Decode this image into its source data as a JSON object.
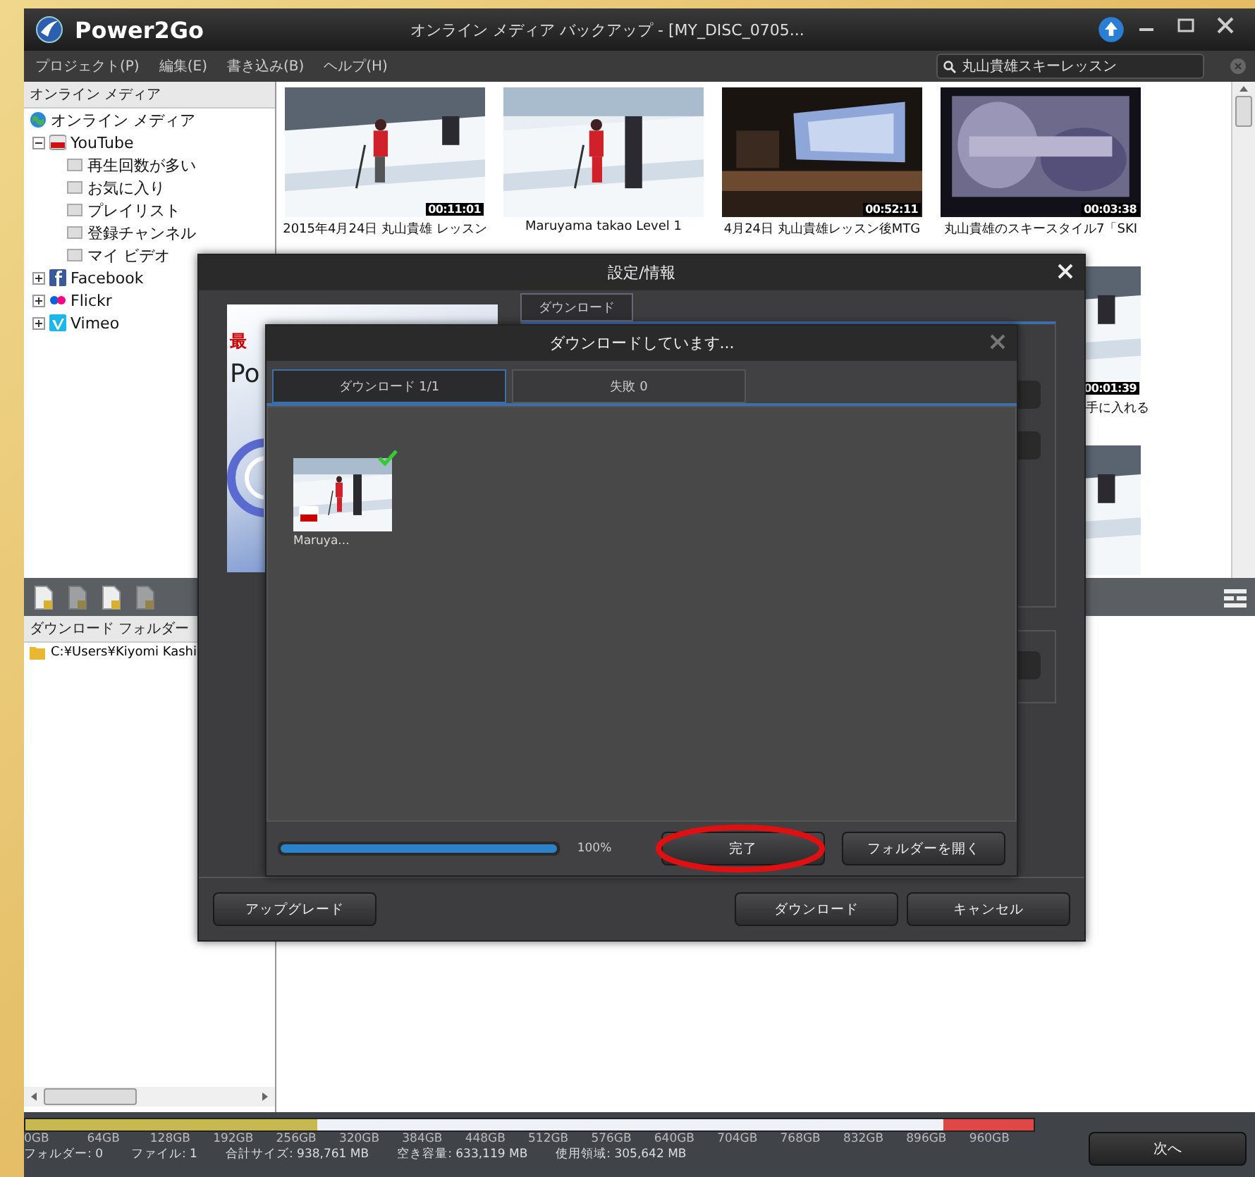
{
  "window": {
    "app_name": "Power2Go",
    "title": "オンライン メディア バックアップ - [MY_DISC_0705..."
  },
  "menu": [
    "プロジェクト(P)",
    "編集(E)",
    "書き込み(B)",
    "ヘルプ(H)"
  ],
  "search": {
    "value": "丸山貴雄スキーレッスン"
  },
  "sidebar": {
    "header": "オンライン メディア",
    "root": {
      "label": "オンライン メディア",
      "children": [
        {
          "label": "YouTube",
          "kind": "youtube",
          "expanded": true,
          "children": [
            {
              "label": "再生回数が多い"
            },
            {
              "label": "お気に入り"
            },
            {
              "label": "プレイリスト"
            },
            {
              "label": "登録チャンネル"
            },
            {
              "label": "マイ ビデオ"
            }
          ]
        },
        {
          "label": "Facebook",
          "kind": "facebook",
          "expanded": false
        },
        {
          "label": "Flickr",
          "kind": "flickr",
          "expanded": false
        },
        {
          "label": "Vimeo",
          "kind": "vimeo",
          "expanded": false
        }
      ]
    }
  },
  "media_rows": [
    [
      {
        "kind": "picture",
        "duration": "00:11:01",
        "caption": "2015年4月24日 丸山貴雄 レッスン"
      },
      {
        "kind": "picture",
        "caption": "Maruyama takao Level 1"
      },
      {
        "kind": "picture",
        "duration": "00:52:11",
        "caption": "4月24日 丸山貴雄レッスン後MTG"
      },
      {
        "kind": "picture",
        "duration": "00:03:38",
        "caption": "丸山貴雄のスキースタイル7「SKI"
      }
    ],
    [
      {
        "kind": "picture",
        "duration": "00:01:39",
        "caption": "手に入れる"
      }
    ],
    [
      {
        "kind": "picture"
      }
    ]
  ],
  "folder_panel": {
    "header": "ダウンロード フォルダー",
    "items": [
      "C:¥Users¥Kiyomi Kashi"
    ]
  },
  "capacity": {
    "level": 0.29,
    "ticks": [
      "0GB",
      "64GB",
      "128GB",
      "192GB",
      "256GB",
      "320GB",
      "384GB",
      "448GB",
      "512GB",
      "576GB",
      "640GB",
      "704GB",
      "768GB",
      "832GB",
      "896GB",
      "960GB"
    ]
  },
  "status": [
    "フォルダー: 0",
    "ファイル: 1",
    "合計サイズ: 938,761 MB",
    "空き容量: 633,119 MB",
    "使用領域: 305,642 MB"
  ],
  "next_button": "次へ",
  "settings_dialog": {
    "title": "設定/情報",
    "tab": "ダウンロード",
    "banner": [
      "最",
      "Po"
    ],
    "buttons": [
      "アップグレード",
      "ダウンロード",
      "キャンセル"
    ]
  },
  "download_dialog": {
    "title": "ダウンロードしています...",
    "tabs": [
      {
        "label": "ダウンロード 1/1",
        "selected": true
      },
      {
        "label": "失敗 0",
        "selected": false
      }
    ],
    "items": [
      {
        "caption": "Maruya...",
        "done": true
      }
    ],
    "progress": {
      "level": 1,
      "reading": "100%"
    },
    "buttons": [
      {
        "label": "完了",
        "highlighted": true
      },
      {
        "label": "フォルダーを開く",
        "highlighted": false
      }
    ]
  }
}
